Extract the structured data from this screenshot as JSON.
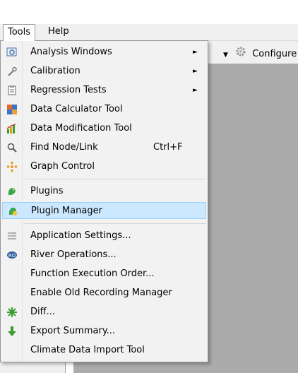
{
  "menubar": {
    "tools": "Tools",
    "help": "Help"
  },
  "toolbar": {
    "configure": "Configure"
  },
  "menu": {
    "items": [
      {
        "label": "Analysis Windows",
        "icon": "analysis-window-icon",
        "submenu": true
      },
      {
        "label": "Calibration",
        "icon": "calibration-icon",
        "submenu": true
      },
      {
        "label": "Regression Tests",
        "icon": "regression-tests-icon",
        "submenu": true
      },
      {
        "label": "Data Calculator Tool",
        "icon": "data-calculator-icon"
      },
      {
        "label": "Data Modification Tool",
        "icon": "data-modification-icon"
      },
      {
        "label": "Find Node/Link",
        "icon": "magnifier-icon",
        "shortcut": "Ctrl+F"
      },
      {
        "label": "Graph Control",
        "icon": "graph-control-icon"
      },
      {
        "label": "Plugins",
        "icon": "plugins-icon"
      },
      {
        "label": "Plugin Manager",
        "icon": "plugin-manager-icon",
        "selected": true
      },
      {
        "label": "Application Settings...",
        "icon": "application-settings-icon"
      },
      {
        "label": "River Operations...",
        "icon": "river-operations-icon"
      },
      {
        "label": "Function Execution Order..."
      },
      {
        "label": "Enable Old Recording Manager"
      },
      {
        "label": "Diff...",
        "icon": "diff-icon"
      },
      {
        "label": "Export Summary...",
        "icon": "export-arrow-icon"
      },
      {
        "label": "Climate Data Import Tool"
      }
    ],
    "submenu_arrow": "►"
  },
  "colors": {
    "selected_bg": "#cce8ff",
    "selected_border": "#99d1ff",
    "workspace": "#ababab"
  }
}
